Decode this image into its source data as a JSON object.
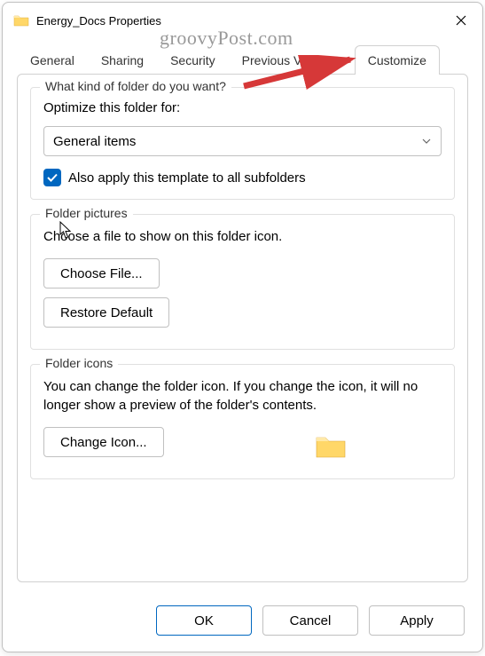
{
  "window": {
    "title": "Energy_Docs Properties"
  },
  "watermark": "groovyPost.com",
  "tabs": {
    "general": "General",
    "sharing": "Sharing",
    "security": "Security",
    "previous_versions": "Previous Versions",
    "customize": "Customize"
  },
  "customize": {
    "kind": {
      "title": "What kind of folder do you want?",
      "label": "Optimize this folder for:",
      "selected": "General items",
      "checkbox_label": "Also apply this template to all subfolders"
    },
    "pictures": {
      "title": "Folder pictures",
      "desc": "Choose a file to show on this folder icon.",
      "choose": "Choose File...",
      "restore": "Restore Default"
    },
    "icons": {
      "title": "Folder icons",
      "desc": "You can change the folder icon. If you change the icon, it will no longer show a preview of the folder's contents.",
      "change": "Change Icon..."
    }
  },
  "footer": {
    "ok": "OK",
    "cancel": "Cancel",
    "apply": "Apply"
  }
}
